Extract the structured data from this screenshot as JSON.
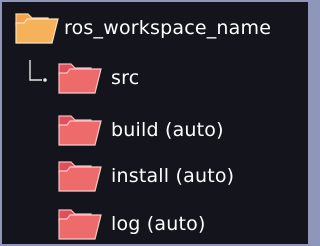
{
  "tree": {
    "root": {
      "label": "ros_workspace_name",
      "icon": "folder-open-icon",
      "color": "#f6b15a"
    },
    "children": [
      {
        "label": "src",
        "icon": "folder-open-icon",
        "color": "#ee6b6b"
      },
      {
        "label": "build (auto)",
        "icon": "folder-open-icon",
        "color": "#ee6b6b"
      },
      {
        "label": "install (auto)",
        "icon": "folder-open-icon",
        "color": "#ee6b6b"
      },
      {
        "label": "log (auto)",
        "icon": "folder-open-icon",
        "color": "#ee6b6b"
      }
    ]
  }
}
